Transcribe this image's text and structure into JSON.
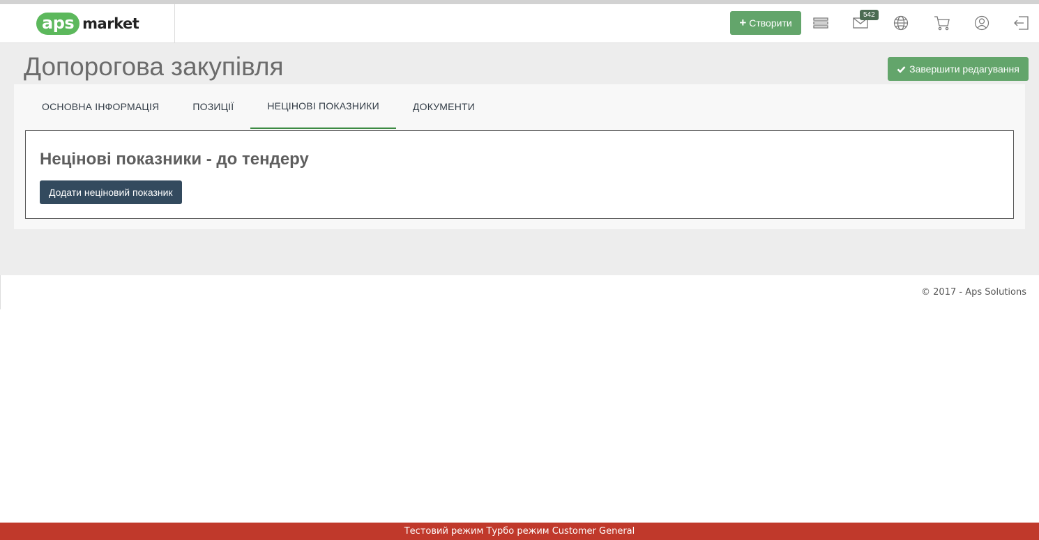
{
  "header": {
    "logo": {
      "brand": "aps",
      "word": "market"
    },
    "create_label": "Створити",
    "messages_badge": "542",
    "icons": [
      "list-icon",
      "mail-icon",
      "globe-icon",
      "cart-icon",
      "user-icon",
      "logout-icon"
    ]
  },
  "page": {
    "title": "Допорогова закупівля",
    "finish_label": "Завершити редагування"
  },
  "tabs": [
    {
      "label": "ОСНОВНА ІНФОРМАЦІЯ",
      "active": false
    },
    {
      "label": "ПОЗИЦІЇ",
      "active": false
    },
    {
      "label": "НЕЦІНОВІ ПОКАЗНИКИ",
      "active": true
    },
    {
      "label": "ДОКУМЕНТИ",
      "active": false
    }
  ],
  "section": {
    "title": "Нецінові показники - до тендеру",
    "add_label": "Додати неціновий показник"
  },
  "footer": {
    "copyright": "© 2017 - Aps Solutions"
  },
  "status_bar": {
    "text": "Тестовий режим Турбо режим Customer General"
  },
  "colors": {
    "accent": "#63a56b",
    "dark_button": "#334a5e",
    "status_bar": "#c0392b"
  }
}
